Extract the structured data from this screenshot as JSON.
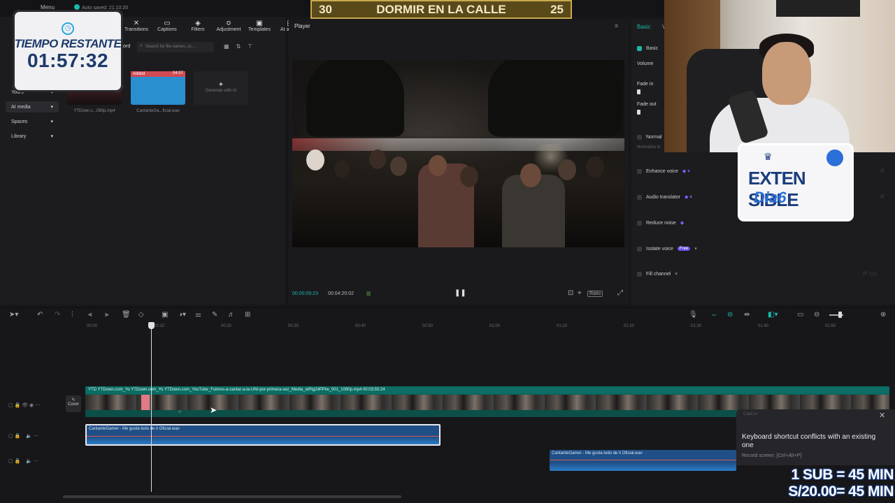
{
  "topbar": {
    "menu": "Menu",
    "saved": "Auto saved: 21:10:20"
  },
  "media": {
    "tabs": [
      {
        "icon": "✕",
        "label": "Transitions"
      },
      {
        "icon": "▭",
        "label": "Captions"
      },
      {
        "icon": "◈",
        "label": "Filters"
      },
      {
        "icon": "≎",
        "label": "Adjustment"
      },
      {
        "icon": "▣",
        "label": "Templates"
      },
      {
        "icon": "◰",
        "label": "AI avatar"
      }
    ],
    "search_placeholder": "Search for file names, sc...",
    "nav": [
      "Yours",
      "AI media",
      "Spaces",
      "Library"
    ],
    "items": [
      {
        "name": "YTDown.c...080p.mp4"
      },
      {
        "name": "CantanteGa...ficial.wav",
        "badge": "Added",
        "duration": "04:07"
      },
      {
        "name": "Generate with AI"
      }
    ],
    "record_label": "ord"
  },
  "timer": {
    "label": "TIEMPO RESTANTE",
    "value": "01:57:32"
  },
  "banner": {
    "left": "30",
    "title": "DORMIR EN LA CALLE",
    "right": "25"
  },
  "player": {
    "title": "Player",
    "time_current": "00:00:09:23",
    "time_total": "00:04:20:02",
    "ratio": "Ratio"
  },
  "inspector": {
    "tab": "Basic",
    "tab2": "V",
    "basic": "Basic",
    "volume": "Volume",
    "fade_in": "Fade in",
    "fade_out": "Fade out",
    "normalize": "Normal",
    "normalize_sub": "Normalize lo",
    "enhance": "Enhance voice",
    "translator": "Audio translator",
    "reduce": "Reduce noise",
    "isolate": "Isolate voice",
    "isolate_badge": "Free",
    "fill": "Fill channel"
  },
  "logo": {
    "line1": "EXTEN SIBLE",
    "line2": "Dia6"
  },
  "timeline": {
    "ticks": [
      "00:00",
      "00:10",
      "00:20",
      "00:30",
      "00:40",
      "00:50",
      "01:00",
      "01:10",
      "01:20",
      "01:30",
      "01:40",
      "01:50"
    ],
    "video_clip": "YTD   YTDown.com_Yo   YTDown.com_Yo   YTDown.com_YouTube_Fuimos-a-cantar-a-la-UNI-por-primera-vez_Media_eiPtg24PPiw_001_1080p.mp4   00:03:55:24",
    "cover": "Cover",
    "audio_clip_1": "CantanteGamer - Me gusta todo de ti Oficial.wav",
    "audio_clip_2": "CantanteGamer - Me gusta todo de ti Oficial.wav"
  },
  "toast": {
    "brand": "CapCut",
    "message": "Keyboard shortcut conflicts with an existing one",
    "sub": "Record screen: [Ctrl+Alt+P]"
  },
  "donate": {
    "line1": "1 SUB = 45 MIN",
    "line2": "S/20.00= 45 MIN"
  }
}
